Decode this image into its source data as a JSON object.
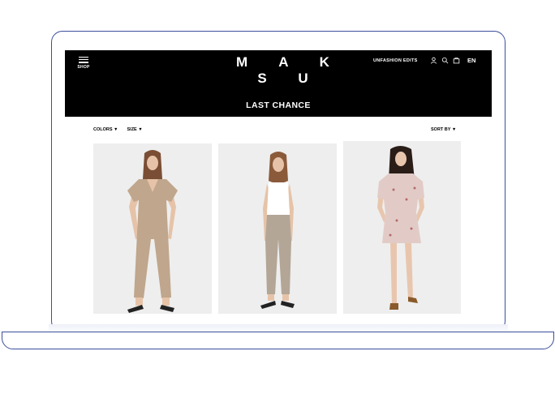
{
  "header": {
    "menu_label": "SHOP",
    "logo": "M A K S U",
    "edits_label": "UNFASHION  EDITS",
    "language": "EN",
    "icons": [
      "user-icon",
      "search-icon",
      "bag-icon"
    ]
  },
  "page": {
    "title": "LAST CHANCE"
  },
  "filters": {
    "colors": "COLORS ▼",
    "size": "SIZE ▼",
    "sort": "SORT BY ▼"
  },
  "products": [
    {
      "image": "model in beige short-sleeve jumpsuit",
      "colors": {
        "garment": "#bfa68c",
        "background": "#eeeeee"
      }
    },
    {
      "image": "model in white tank top and beige trousers",
      "colors": {
        "garment": "#b3a697",
        "background": "#eeeeee"
      }
    },
    {
      "image": "model in floral short dress",
      "colors": {
        "garment": "#e2cbc6",
        "background": "#eeeeee"
      }
    }
  ],
  "colors": {
    "frame": "#3b4f9c",
    "header_bg": "#000000",
    "header_text": "#ffffff"
  }
}
